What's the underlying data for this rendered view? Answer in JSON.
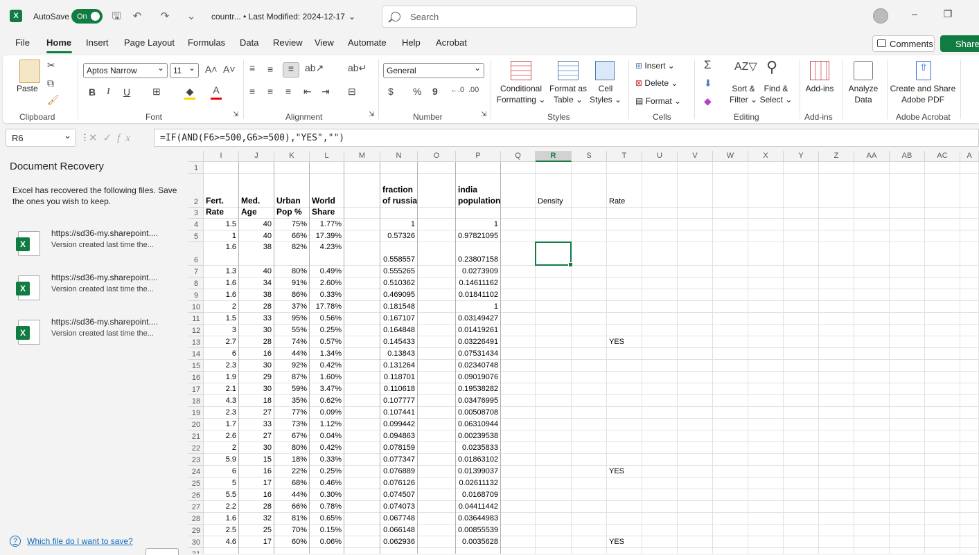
{
  "titlebar": {
    "autosave_label": "AutoSave",
    "autosave_state": "On",
    "doc_title": "countr...  •  Last Modified: 2024-12-17",
    "search_placeholder": "Search"
  },
  "menu": {
    "tabs": [
      "File",
      "Home",
      "Insert",
      "Page Layout",
      "Formulas",
      "Data",
      "Review",
      "View",
      "Automate",
      "Help",
      "Acrobat"
    ],
    "active": "Home",
    "comments": "Comments",
    "share": "Share"
  },
  "ribbon": {
    "clipboard": {
      "label": "Clipboard",
      "paste": "Paste"
    },
    "font": {
      "label": "Font",
      "name": "Aptos Narrow",
      "size": "11",
      "bold": "B",
      "italic": "I",
      "underline": "U"
    },
    "alignment": {
      "label": "Alignment"
    },
    "number": {
      "label": "Number",
      "format": "General"
    },
    "styles": {
      "label": "Styles",
      "conditional": "Conditional",
      "conditional2": "Formatting",
      "format_table": "Format as",
      "format_table2": "Table",
      "cell_styles": "Cell",
      "cell_styles2": "Styles"
    },
    "cells": {
      "label": "Cells",
      "insert": "Insert",
      "delete": "Delete",
      "format": "Format"
    },
    "editing": {
      "label": "Editing",
      "sort": "Sort &",
      "sort2": "Filter",
      "find": "Find &",
      "find2": "Select"
    },
    "addins": {
      "label": "Add-ins",
      "addins": "Add-ins",
      "analyze": "Analyze",
      "analyze2": "Data"
    },
    "acrobat": {
      "label": "Adobe Acrobat",
      "create": "Create and Share",
      "create2": "Adobe PDF"
    }
  },
  "formula_bar": {
    "name_box": "R6",
    "formula": "=IF(AND(F6>=500,G6>=500),\"YES\",\"\")"
  },
  "recovery": {
    "title": "Document Recovery",
    "description": "Excel has recovered the following files.  Save the ones you wish to keep.",
    "files": [
      {
        "url": "https://sd36-my.sharepoint....",
        "version": "Version created last time the..."
      },
      {
        "url": "https://sd36-my.sharepoint....",
        "version": "Version created last time the..."
      },
      {
        "url": "https://sd36-my.sharepoint....",
        "version": "Version created last time the..."
      }
    ],
    "help_link": "Which file do I want to save?"
  },
  "sheet": {
    "columns": [
      "I",
      "J",
      "K",
      "L",
      "M",
      "N",
      "O",
      "P",
      "Q",
      "R",
      "S",
      "T",
      "U",
      "V",
      "W",
      "X",
      "Y",
      "Z",
      "AA",
      "AB",
      "AC",
      "A"
    ],
    "selected_column": "R",
    "header_row": {
      "I": [
        "Fert.",
        "Rate"
      ],
      "J": [
        "Med.",
        "Age"
      ],
      "K": [
        "Urban",
        "Pop %"
      ],
      "L": [
        "World",
        "Share"
      ],
      "N": [
        "fraction",
        "of russia"
      ],
      "P": [
        "india",
        "population"
      ],
      "R": "Density",
      "T": "Rate"
    },
    "rows": [
      {
        "n": "4",
        "I": "1.5",
        "J": "40",
        "K": "75%",
        "L": "1.77%",
        "N": "1",
        "P": "1",
        "T": ""
      },
      {
        "n": "5",
        "I": "1",
        "J": "40",
        "K": "66%",
        "L": "17.39%",
        "N": "0.57326",
        "P": "0.97821095",
        "T": ""
      },
      {
        "n": "6",
        "I": "1.6",
        "J": "38",
        "K": "82%",
        "L": "4.23%",
        "N": "0.558557",
        "P": "0.23807158",
        "T": ""
      },
      {
        "n": "7",
        "I": "1.3",
        "J": "40",
        "K": "80%",
        "L": "0.49%",
        "N": "0.555265",
        "P": "0.0273909",
        "T": ""
      },
      {
        "n": "8",
        "I": "1.6",
        "J": "34",
        "K": "91%",
        "L": "2.60%",
        "N": "0.510362",
        "P": "0.14611162",
        "T": ""
      },
      {
        "n": "9",
        "I": "1.6",
        "J": "38",
        "K": "86%",
        "L": "0.33%",
        "N": "0.469095",
        "P": "0.01841102",
        "T": ""
      },
      {
        "n": "10",
        "I": "2",
        "J": "28",
        "K": "37%",
        "L": "17.78%",
        "N": "0.181548",
        "P": "1",
        "T": ""
      },
      {
        "n": "11",
        "I": "1.5",
        "J": "33",
        "K": "95%",
        "L": "0.56%",
        "N": "0.167107",
        "P": "0.03149427",
        "T": ""
      },
      {
        "n": "12",
        "I": "3",
        "J": "30",
        "K": "55%",
        "L": "0.25%",
        "N": "0.164848",
        "P": "0.01419261",
        "T": ""
      },
      {
        "n": "13",
        "I": "2.7",
        "J": "28",
        "K": "74%",
        "L": "0.57%",
        "N": "0.145433",
        "P": "0.03226491",
        "T": "YES"
      },
      {
        "n": "14",
        "I": "6",
        "J": "16",
        "K": "44%",
        "L": "1.34%",
        "N": "0.13843",
        "P": "0.07531434",
        "T": ""
      },
      {
        "n": "15",
        "I": "2.3",
        "J": "30",
        "K": "92%",
        "L": "0.42%",
        "N": "0.131264",
        "P": "0.02340748",
        "T": ""
      },
      {
        "n": "16",
        "I": "1.9",
        "J": "29",
        "K": "87%",
        "L": "1.60%",
        "N": "0.118701",
        "P": "0.09019076",
        "T": ""
      },
      {
        "n": "17",
        "I": "2.1",
        "J": "30",
        "K": "59%",
        "L": "3.47%",
        "N": "0.110618",
        "P": "0.19538282",
        "T": ""
      },
      {
        "n": "18",
        "I": "4.3",
        "J": "18",
        "K": "35%",
        "L": "0.62%",
        "N": "0.107777",
        "P": "0.03476995",
        "T": ""
      },
      {
        "n": "19",
        "I": "2.3",
        "J": "27",
        "K": "77%",
        "L": "0.09%",
        "N": "0.107441",
        "P": "0.00508708",
        "T": ""
      },
      {
        "n": "20",
        "I": "1.7",
        "J": "33",
        "K": "73%",
        "L": "1.12%",
        "N": "0.099442",
        "P": "0.06310944",
        "T": ""
      },
      {
        "n": "21",
        "I": "2.6",
        "J": "27",
        "K": "67%",
        "L": "0.04%",
        "N": "0.094863",
        "P": "0.00239538",
        "T": ""
      },
      {
        "n": "22",
        "I": "2",
        "J": "30",
        "K": "80%",
        "L": "0.42%",
        "N": "0.078159",
        "P": "0.0235833",
        "T": ""
      },
      {
        "n": "23",
        "I": "5.9",
        "J": "15",
        "K": "18%",
        "L": "0.33%",
        "N": "0.077347",
        "P": "0.01863102",
        "T": ""
      },
      {
        "n": "24",
        "I": "6",
        "J": "16",
        "K": "22%",
        "L": "0.25%",
        "N": "0.076889",
        "P": "0.01399037",
        "T": "YES"
      },
      {
        "n": "25",
        "I": "5",
        "J": "17",
        "K": "68%",
        "L": "0.46%",
        "N": "0.076126",
        "P": "0.02611132",
        "T": ""
      },
      {
        "n": "26",
        "I": "5.5",
        "J": "16",
        "K": "44%",
        "L": "0.30%",
        "N": "0.074507",
        "P": "0.0168709",
        "T": ""
      },
      {
        "n": "27",
        "I": "2.2",
        "J": "28",
        "K": "66%",
        "L": "0.78%",
        "N": "0.074073",
        "P": "0.04411442",
        "T": ""
      },
      {
        "n": "28",
        "I": "1.6",
        "J": "32",
        "K": "81%",
        "L": "0.65%",
        "N": "0.067748",
        "P": "0.03644983",
        "T": ""
      },
      {
        "n": "29",
        "I": "2.5",
        "J": "25",
        "K": "70%",
        "L": "0.15%",
        "N": "0.066148",
        "P": "0.00855539",
        "T": ""
      },
      {
        "n": "30",
        "I": "4.6",
        "J": "17",
        "K": "60%",
        "L": "0.06%",
        "N": "0.062936",
        "P": "0.0035628",
        "T": "YES"
      }
    ]
  },
  "colors": {
    "accent": "#107c41"
  }
}
